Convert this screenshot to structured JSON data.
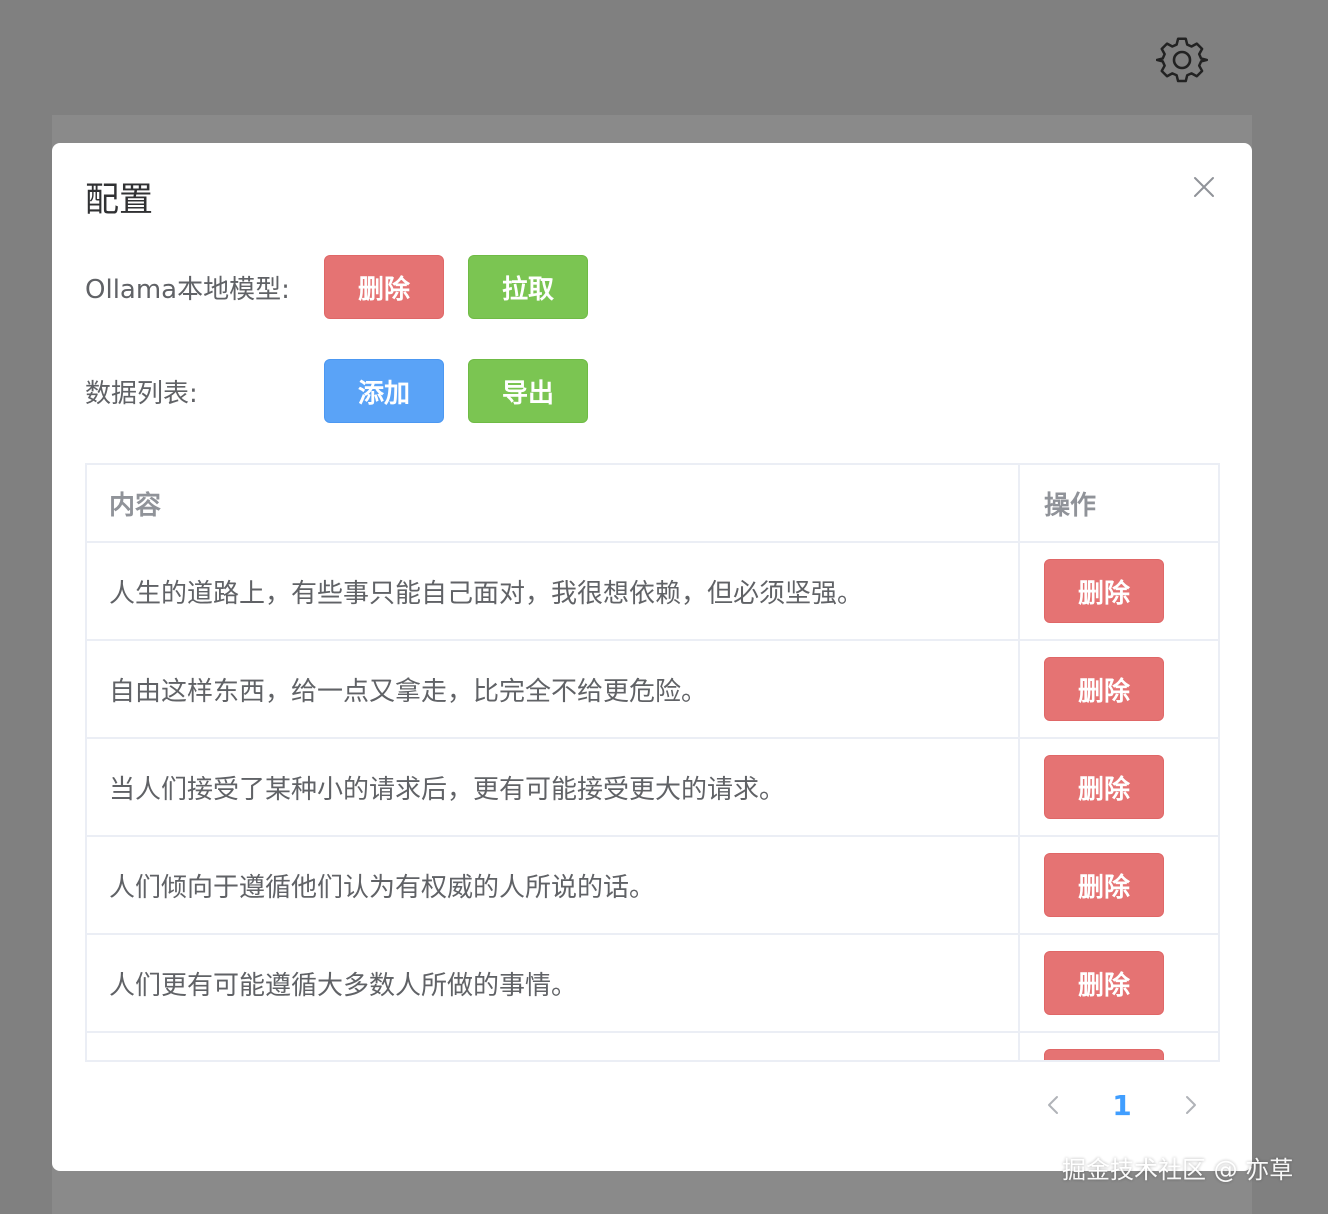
{
  "gear_icon": "gear-icon",
  "modal": {
    "title": "配置",
    "close_icon": "close-icon"
  },
  "ollama": {
    "label": "Ollama本地模型:",
    "delete_label": "删除",
    "pull_label": "拉取"
  },
  "datalist": {
    "label": "数据列表:",
    "add_label": "添加",
    "export_label": "导出"
  },
  "table": {
    "headers": {
      "content": "内容",
      "action": "操作"
    },
    "rows": [
      {
        "content": "人生的道路上，有些事只能自己面对，我很想依赖，但必须坚强。",
        "action": "删除"
      },
      {
        "content": "自由这样东西，给一点又拿走，比完全不给更危险。",
        "action": "删除"
      },
      {
        "content": "当人们接受了某种小的请求后，更有可能接受更大的请求。",
        "action": "删除"
      },
      {
        "content": "人们倾向于遵循他们认为有权威的人所说的话。",
        "action": "删除"
      },
      {
        "content": "人们更有可能遵循大多数人所做的事情。",
        "action": "删除"
      },
      {
        "content": "",
        "action": ""
      }
    ]
  },
  "pagination": {
    "current_page": "1",
    "prev_icon": "chevron-left-icon",
    "next_icon": "chevron-right-icon"
  },
  "watermark": "掘金技术社区 @ 亦草",
  "colors": {
    "danger": "#e57373",
    "success": "#7bc552",
    "primary": "#5aa3f7",
    "page_active": "#409eff"
  }
}
